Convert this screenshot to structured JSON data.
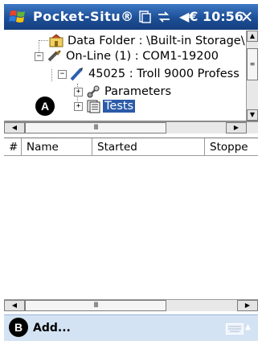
{
  "title_bar": {
    "app_name": "Pocket-Situ®",
    "time": "◀€ 10:56",
    "close_label": "✕"
  },
  "tree": {
    "items": [
      {
        "label": "Data Folder : \\Built-in Storage\\",
        "icon": "data-folder-icon"
      },
      {
        "label": "On-Line (1) : COM1-19200",
        "icon": "cable-icon"
      },
      {
        "label": "45025 : Troll 9000 Profess",
        "icon": "instrument-icon"
      },
      {
        "label": "Parameters",
        "icon": "parameters-icon"
      },
      {
        "label": "Tests",
        "icon": "tests-icon",
        "selected": true
      }
    ]
  },
  "list": {
    "columns": [
      "#",
      "Name",
      "Started",
      "Stoppe"
    ]
  },
  "scroll": {
    "thumb_glyph": "III"
  },
  "menu": {
    "add_label": "Add..."
  },
  "callouts": {
    "a": "A",
    "b": "B"
  },
  "colors": {
    "title_bar": "#1d4f97",
    "selection": "#2a5aa8",
    "menu_bar": "#d4e3f4"
  }
}
